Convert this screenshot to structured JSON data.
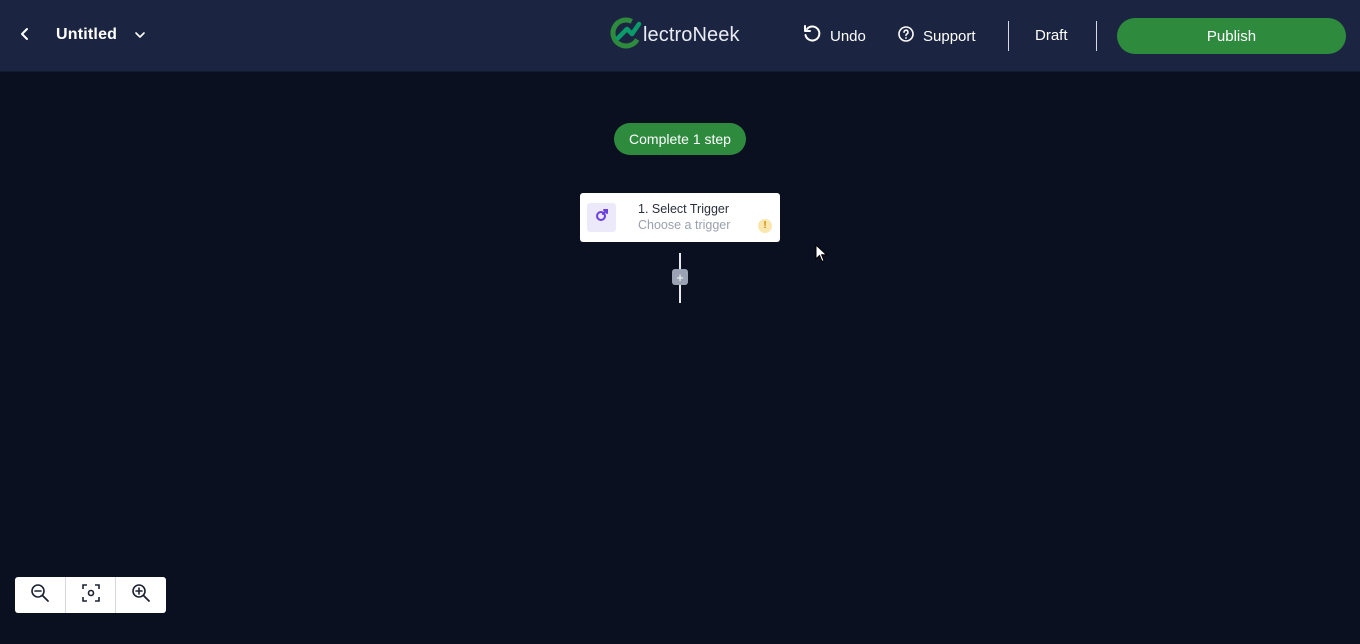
{
  "header": {
    "title": "Untitled",
    "logo_text": "lectroNeek",
    "undo_label": "Undo",
    "support_label": "Support",
    "status_label": "Draft",
    "publish_label": "Publish"
  },
  "canvas": {
    "progress_label": "Complete 1 step",
    "trigger": {
      "title": "1. Select Trigger",
      "subtitle": "Choose a trigger",
      "warning_glyph": "!"
    },
    "add_step_glyph": "+"
  },
  "icons": {
    "back": "chevron-left-icon",
    "title_menu": "chevron-down-icon",
    "undo": "undo-icon",
    "support": "help-circle-icon",
    "trigger": "trigger-icon",
    "zoom_out": "zoom-out-icon",
    "fit": "fit-to-screen-icon",
    "zoom_in": "zoom-in-icon"
  },
  "colors": {
    "topbar": "#1b2541",
    "canvas": "#0b1020",
    "accent_green": "#2e8b3e",
    "trigger_purple": "#6a3fe0",
    "warning": "#e8a317"
  }
}
